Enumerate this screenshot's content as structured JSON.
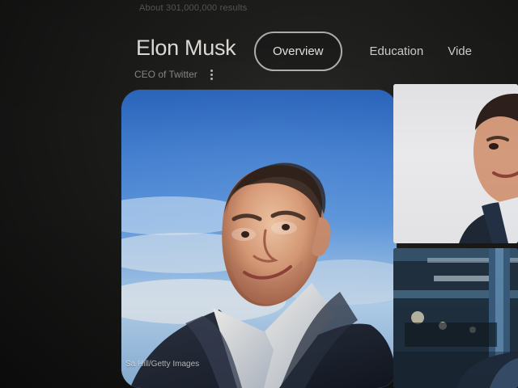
{
  "header": {
    "faint_results_text": "About 301,000,000 results",
    "title": "Elon Musk",
    "subtitle": "CEO of Twitter"
  },
  "tabs": [
    {
      "label": "Overview",
      "active": true
    },
    {
      "label": "Education",
      "active": false
    },
    {
      "label": "Vide",
      "active": false
    }
  ],
  "photo": {
    "caption": "Sa Hill/Getty Images"
  },
  "icons": {
    "more": "more-vertical-icon"
  },
  "colors": {
    "page_background": "#141414",
    "title_text": "#e7e4df",
    "subtitle_text": "#8c8a85",
    "tab_border": "#b9b6b0"
  }
}
